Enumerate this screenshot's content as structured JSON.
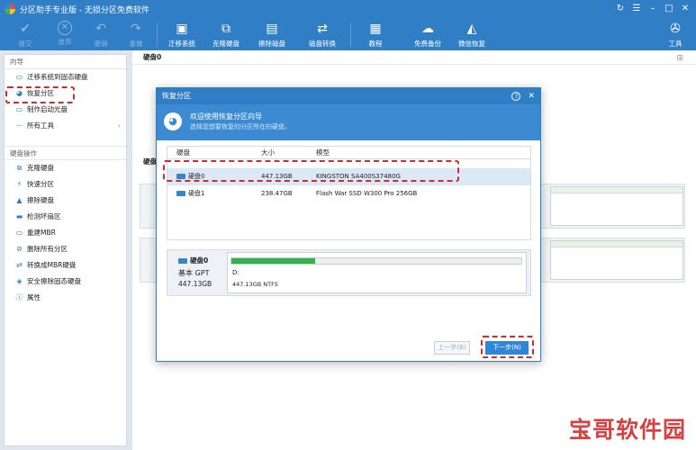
{
  "window": {
    "title": "分区助手专业版 - 无损分区免费软件",
    "controls": [
      "↻",
      "☰",
      "–",
      "□",
      "✕"
    ]
  },
  "toolbar": {
    "items": [
      {
        "label": "提交",
        "icon": "check-icon",
        "enabled": false
      },
      {
        "label": "放弃",
        "icon": "discard-icon",
        "enabled": false
      },
      {
        "label": "撤销",
        "icon": "undo-icon",
        "enabled": false
      },
      {
        "label": "重做",
        "icon": "redo-icon",
        "enabled": false
      },
      {
        "label": "迁移系统",
        "icon": "migrate-os-icon",
        "enabled": true
      },
      {
        "label": "克隆硬盘",
        "icon": "clone-disk-icon",
        "enabled": true
      },
      {
        "label": "擦除磁盘",
        "icon": "wipe-disk-icon",
        "enabled": true
      },
      {
        "label": "磁盘转换",
        "icon": "convert-disk-icon",
        "enabled": true
      },
      {
        "label": "教程",
        "icon": "tutorial-icon",
        "enabled": true
      },
      {
        "label": "免费备份",
        "icon": "backup-icon",
        "enabled": true
      },
      {
        "label": "微信恢复",
        "icon": "wechat-recovery-icon",
        "enabled": true
      },
      {
        "label": "工具",
        "icon": "tools-icon",
        "enabled": true
      }
    ]
  },
  "sidebar": {
    "wizard_title": "向导",
    "wizard_items": [
      {
        "label": "迁移系统到固态硬盘",
        "icon": "migrate-icon"
      },
      {
        "label": "恢复分区",
        "icon": "recover-partition-icon"
      },
      {
        "label": "制作启动光盘",
        "icon": "boot-disc-icon"
      },
      {
        "label": "所有工具",
        "icon": "more-icon"
      }
    ],
    "disk_ops_title": "硬盘操作",
    "disk_ops_items": [
      {
        "label": "克隆硬盘",
        "icon": "clone-icon"
      },
      {
        "label": "快速分区",
        "icon": "quick-partition-icon"
      },
      {
        "label": "擦除硬盘",
        "icon": "wipe-icon"
      },
      {
        "label": "检测坏扇区",
        "icon": "bad-sector-icon"
      },
      {
        "label": "重建MBR",
        "icon": "rebuild-mbr-icon"
      },
      {
        "label": "删除所有分区",
        "icon": "delete-all-icon"
      },
      {
        "label": "转换成MBR硬盘",
        "icon": "convert-mbr-icon"
      },
      {
        "label": "安全擦除固态硬盘",
        "icon": "secure-erase-icon"
      },
      {
        "label": "属性",
        "icon": "info-icon"
      }
    ]
  },
  "main": {
    "disk0_header": "硬盘0",
    "disk_label_bg": "硬盘"
  },
  "dialog": {
    "title": "恢复分区",
    "banner_title": "欢迎使用恢复分区向导",
    "banner_subtitle": "选择您想要恢复的分区所在的硬盘。",
    "table": {
      "headers": [
        "硬盘",
        "大小",
        "模型"
      ],
      "rows": [
        {
          "disk": "硬盘0",
          "size": "447.13GB",
          "model": "KINGSTON SA400S37480G",
          "selected": true
        },
        {
          "disk": "硬盘1",
          "size": "238.47GB",
          "model": "Flash War SSD W300 Pro 256GB",
          "selected": false
        }
      ]
    },
    "preview": {
      "disk_name": "硬盘0",
      "disk_type": "基本 GPT",
      "disk_size": "447.13GB",
      "partition_letter": "D:",
      "partition_info": "447.13GB NTFS",
      "used_fraction": 0.29
    },
    "btn_prev": "上一步(B)",
    "btn_next": "下一步(N)"
  },
  "watermark": "宝哥软件园",
  "colors": {
    "accent": "#2f7ec6",
    "highlight": "#d12b2b",
    "usage_bar": "#34b24a"
  }
}
